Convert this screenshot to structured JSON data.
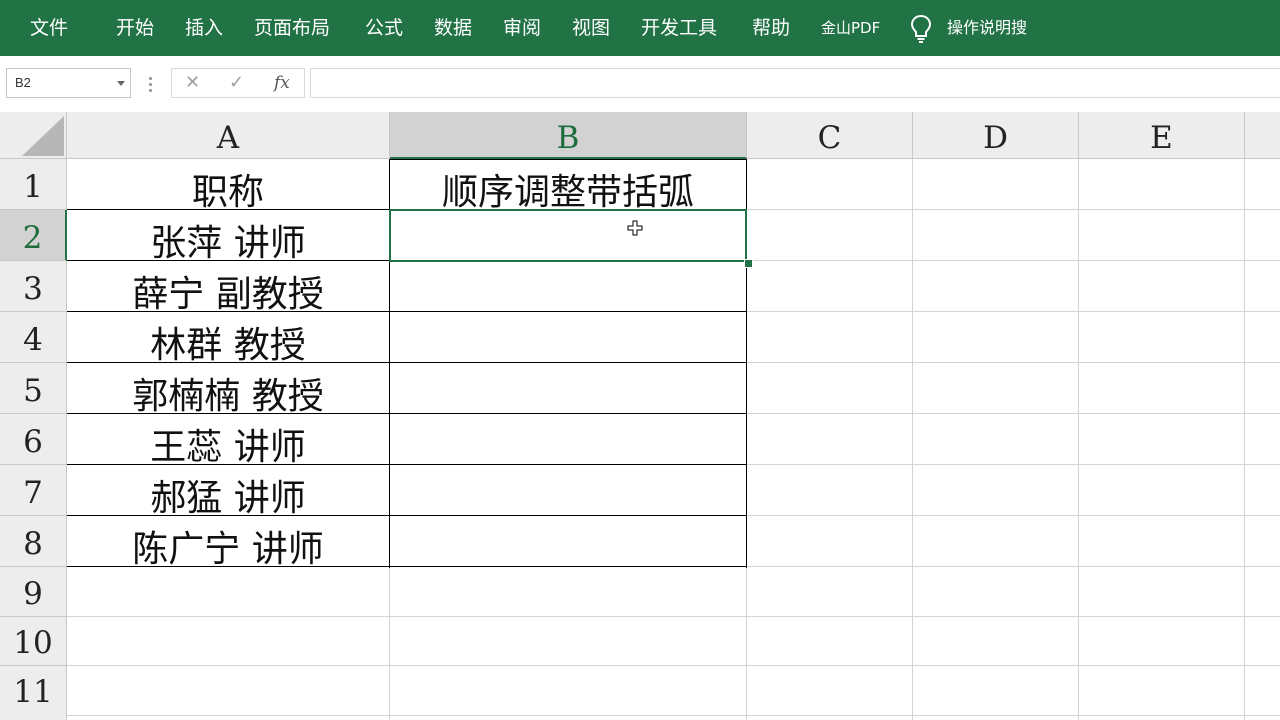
{
  "ribbon": {
    "tabs": [
      "文件",
      "开始",
      "插入",
      "页面布局",
      "公式",
      "数据",
      "审阅",
      "视图",
      "开发工具",
      "帮助",
      "金山PDF"
    ],
    "tell_me": "操作说明搜"
  },
  "formula_bar": {
    "name_box": "B2",
    "cancel_icon": "✕",
    "enter_icon": "✓",
    "fx_label": "fx",
    "formula": ""
  },
  "sheet": {
    "columns": [
      "A",
      "B",
      "C",
      "D",
      "E"
    ],
    "rows": [
      "1",
      "2",
      "3",
      "4",
      "5",
      "6",
      "7",
      "8",
      "9",
      "10",
      "11"
    ],
    "cells": {
      "A1": "职称",
      "B1": "顺序调整带括弧",
      "A2": "张萍  讲师",
      "A3": "薛宁  副教授",
      "A4": "林群  教授",
      "A5": "郭楠楠  教授",
      "A6": "王蕊  讲师",
      "A7": "郝猛  讲师",
      "A8": "陈广宁  讲师"
    },
    "selected_cell": "B2"
  },
  "colors": {
    "accent": "#217346",
    "header_bg": "#ededed",
    "selected_header_bg": "#d2d2d2"
  }
}
